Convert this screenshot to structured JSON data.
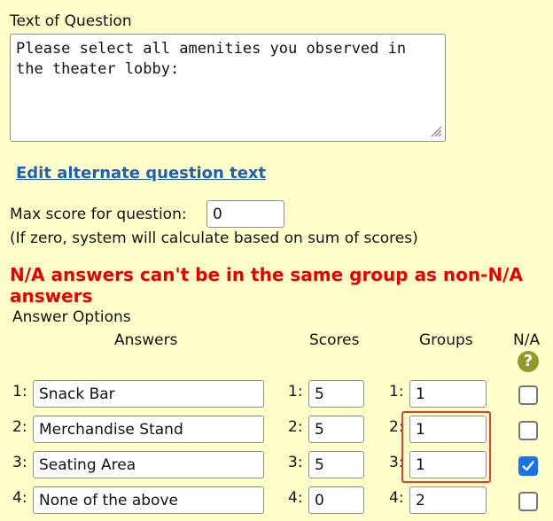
{
  "question": {
    "label": "Text of Question",
    "text": "Please select all amenities you observed in the theater lobby:"
  },
  "alt_link": "Edit alternate question text",
  "max_score": {
    "label": "Max score for question:",
    "value": "0",
    "hint": "(If zero, system will calculate based on sum of scores)"
  },
  "error": "N/A answers can't be in the same group as non-N/A answers",
  "answer_options_label": "Answer Options",
  "headers": {
    "answers": "Answers",
    "scores": "Scores",
    "groups": "Groups",
    "na": "N/A"
  },
  "help_icon": "question-mark-icon",
  "rows": [
    {
      "num": "1:",
      "answer": "Snack Bar",
      "score": "5",
      "group": "1",
      "na": false
    },
    {
      "num": "2:",
      "answer": "Merchandise Stand",
      "score": "5",
      "group": "1",
      "na": false
    },
    {
      "num": "3:",
      "answer": "Seating Area",
      "score": "5",
      "group": "1",
      "na": true
    },
    {
      "num": "4:",
      "answer": "None of the above",
      "score": "0",
      "group": "2",
      "na": false
    }
  ],
  "colors": {
    "background": "#ffffc9",
    "link": "#1f5fb7",
    "error": "#e60000",
    "checkbox_checked": "#1a73e8",
    "highlight_box": "#d9432c"
  }
}
